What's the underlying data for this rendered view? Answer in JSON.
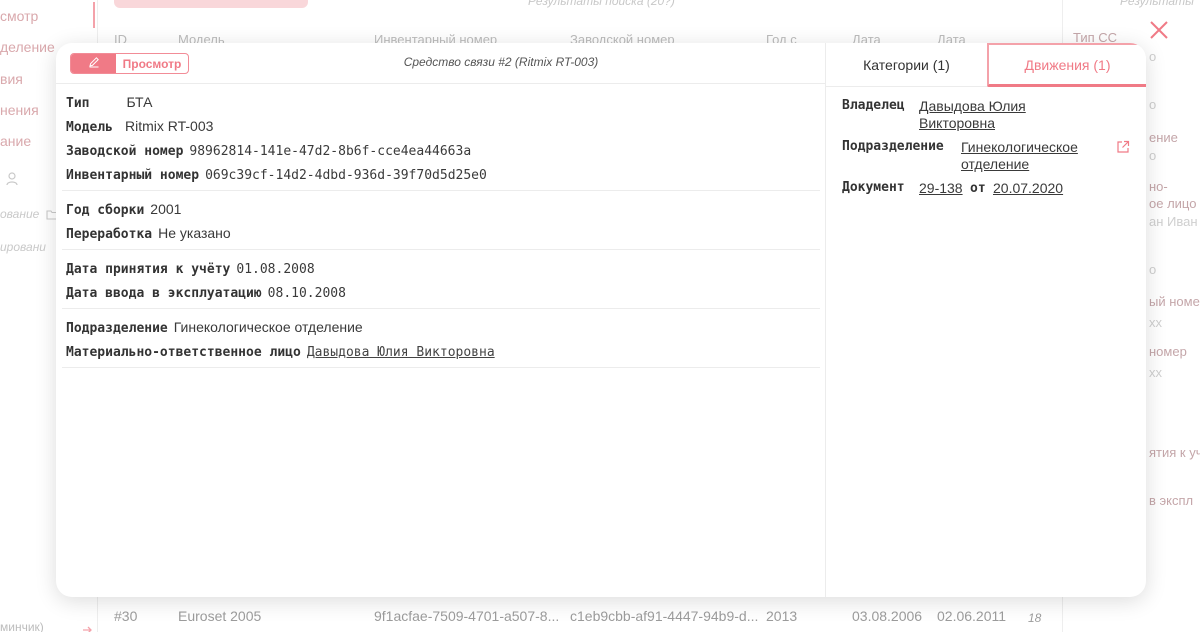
{
  "background": {
    "sidebar": {
      "items": [
        "смотр",
        "деление",
        "вия",
        "нения",
        "ание"
      ],
      "small_items": [
        "ование",
        "ировани"
      ],
      "bottom": "минчик)"
    },
    "results_text": "Результаты поиска (20?)",
    "results_text_right": "Результаты",
    "table_headers": [
      "ID",
      "Модель",
      "Инвентарный номер",
      "Заводской номер",
      "Год с",
      "Дата",
      "Дата"
    ],
    "right_filter": {
      "title": "Тип СС",
      "labels": [
        "о",
        "ение",
        "о",
        "но-",
        "ое лицо",
        "ан Иван",
        "о",
        "ый номе",
        "хх",
        "номер",
        "хх",
        "ятия к уч",
        "в экспл"
      ]
    },
    "row": {
      "id": "#30",
      "model": "Euroset 2005",
      "inventory": "9f1acfae-7509-4701-a507-8...",
      "serial": "c1eb9cbb-af91-4447-94b9-d...",
      "year": "2013",
      "date1": "03.08.2006",
      "date2": "02.06.2011",
      "count": "18"
    }
  },
  "modal": {
    "mode": {
      "view_label": "Просмотр"
    },
    "title": "Средство связи #2 (Ritmix RT-003)",
    "fields": {
      "type": {
        "label": "Тип",
        "value": "БТА"
      },
      "model": {
        "label": "Модель",
        "value": "Ritmix RT-003"
      },
      "serial": {
        "label": "Заводской номер",
        "value": "98962814-141e-47d2-8b6f-cce4ea44663a"
      },
      "inventory": {
        "label": "Инвентарный номер",
        "value": "069c39cf-14d2-4dbd-936d-39f70d5d25e0"
      },
      "year": {
        "label": "Год сборки",
        "value": "2001"
      },
      "rework": {
        "label": "Переработка",
        "value": "Не указано"
      },
      "accepted": {
        "label": "Дата принятия к учёту",
        "value": "01.08.2008"
      },
      "commissioned": {
        "label": "Дата ввода в эксплуатацию",
        "value": "08.10.2008"
      },
      "department": {
        "label": "Подразделение",
        "value": "Гинекологическое отделение"
      },
      "responsible": {
        "label": "Материально-ответственное лицо",
        "value": "Давыдова Юлия Викторовна"
      }
    },
    "tabs": {
      "categories": "Категории (1)",
      "movements": "Движения (1)"
    },
    "movement": {
      "owner_label": "Владелец",
      "owner_line1": "Давыдова Юлия",
      "owner_line2": "Викторовна",
      "department_label": "Подразделение",
      "department_line1": "Гинекологическое",
      "department_line2": "отделение",
      "document_label": "Документ",
      "document_number": "29-138",
      "from_label": "от",
      "document_date": "20.07.2020"
    }
  },
  "colors": {
    "accent": "#f07a86",
    "accent_light": "#f4a2aa"
  }
}
